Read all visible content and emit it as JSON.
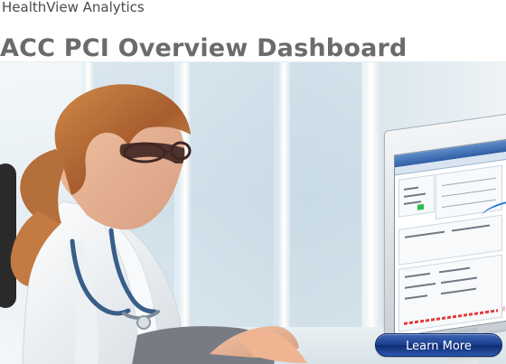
{
  "header": {
    "subtitle": "HealthView Analytics",
    "title": "ACC PCI Overview Dashboard"
  },
  "hero": {
    "image_subject": "clinician-viewing-dashboard",
    "monitor_icon": "monitor-dashboard-icon"
  },
  "actions": {
    "learn_more_label": "Learn More"
  },
  "colors": {
    "title_gray": "#6b6b6b",
    "button_blue": "#1b3f8d",
    "screen_blue": "#2f5ea7",
    "hero_blue": "#d6e4ec"
  }
}
